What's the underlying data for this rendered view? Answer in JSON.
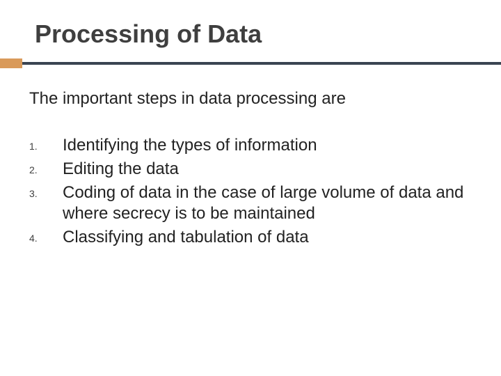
{
  "title": "Processing of Data",
  "intro": "The important steps in data processing are",
  "items": [
    {
      "num": "1.",
      "text": "Identifying the types of information"
    },
    {
      "num": "2.",
      "text": "Editing the data"
    },
    {
      "num": "3.",
      "text": "Coding of data in the case of large volume of data and where secrecy is to be maintained"
    },
    {
      "num": "4.",
      "text": "Classifying and tabulation of data"
    }
  ],
  "colors": {
    "rule": "#3a4452",
    "accent": "#d99a5a"
  }
}
